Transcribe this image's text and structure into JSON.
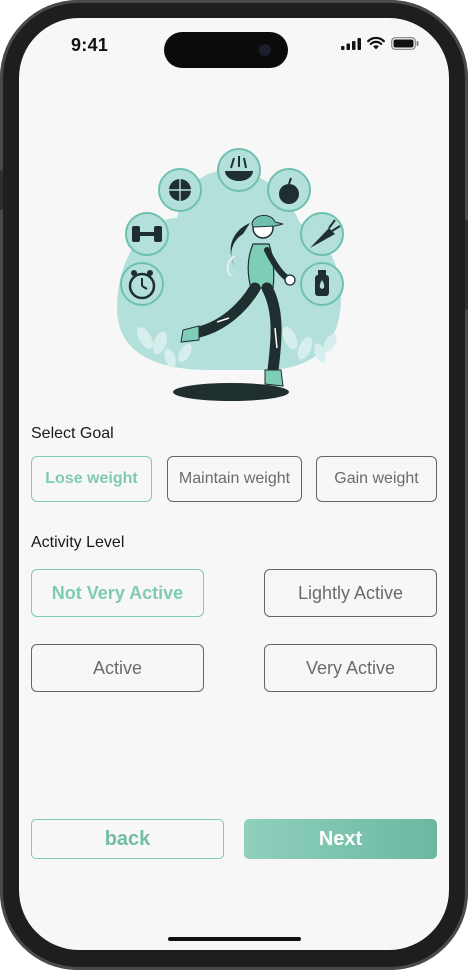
{
  "status_bar": {
    "time": "9:41",
    "icons": [
      "signal-icon",
      "wifi-icon",
      "battery-icon"
    ]
  },
  "illustration": {
    "icons": [
      "clock-icon",
      "dumbbell-icon",
      "basketball-icon",
      "salad-bowl-icon",
      "apple-icon",
      "carrot-icon",
      "water-bottle-icon"
    ],
    "subject": "running-woman"
  },
  "goal": {
    "label": "Select Goal",
    "options": [
      "Lose weight",
      "Maintain weight",
      "Gain weight"
    ],
    "selected": "Lose weight"
  },
  "activity": {
    "label": "Activity Level",
    "options": [
      "Not Very Active",
      "Lightly Active",
      "Active",
      "Very Active"
    ],
    "selected": "Not Very Active"
  },
  "actions": {
    "back_label": "back",
    "next_label": "Next"
  },
  "colors": {
    "accent": "#7fcab5",
    "accent_dark": "#6bb8a1",
    "text_dark": "#1a1a1a",
    "text_muted": "#6b6b6b",
    "screen_bg": "#f7f7f7"
  }
}
